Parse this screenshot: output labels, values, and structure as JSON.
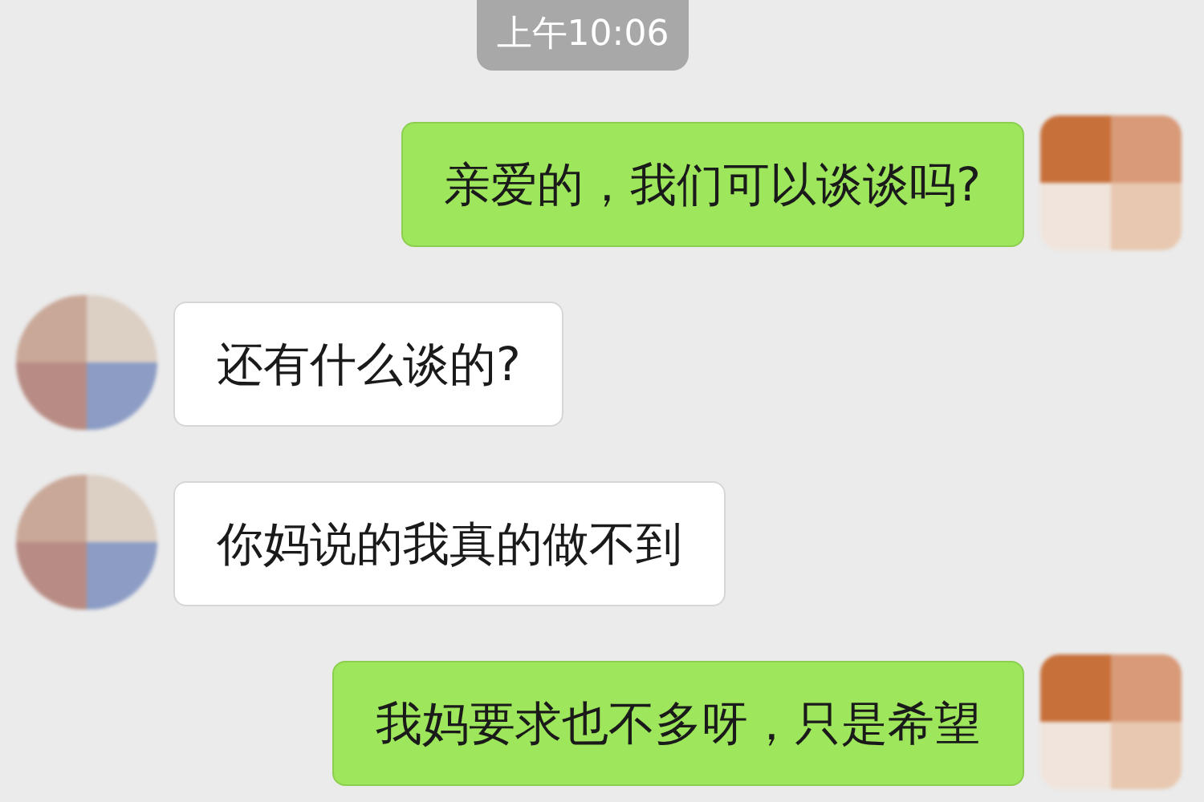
{
  "timestamp": "上午10:06",
  "messages": [
    {
      "kind": "sent",
      "text": "亲爱的，我们可以谈谈吗?"
    },
    {
      "kind": "received",
      "text": "还有什么谈的?"
    },
    {
      "kind": "received",
      "text": "你妈说的我真的做不到"
    },
    {
      "kind": "sent",
      "text": "我妈要求也不多呀，只是希望"
    }
  ]
}
